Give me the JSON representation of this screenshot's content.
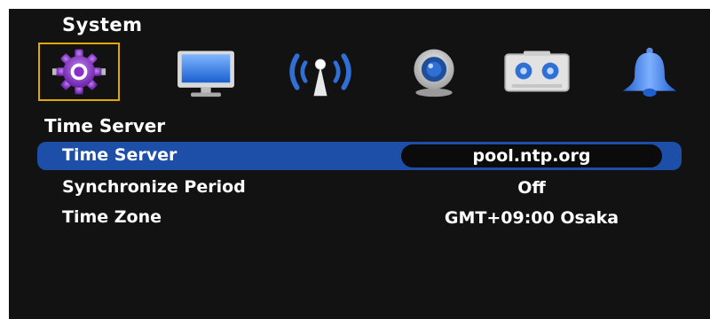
{
  "header": {
    "title": "System"
  },
  "menu_icons": [
    {
      "name": "gear-icon",
      "selected": true
    },
    {
      "name": "monitor-icon",
      "selected": false
    },
    {
      "name": "network-antenna-icon",
      "selected": false
    },
    {
      "name": "webcam-icon",
      "selected": false
    },
    {
      "name": "recorder-icon",
      "selected": false
    },
    {
      "name": "bell-icon",
      "selected": false
    }
  ],
  "section": {
    "title": "Time Server"
  },
  "settings": [
    {
      "label": "Time Server",
      "value": "pool.ntp.org",
      "selected": true
    },
    {
      "label": "Synchronize Period",
      "value": "Off",
      "selected": false
    },
    {
      "label": "Time Zone",
      "value": "GMT+09:00 Osaka",
      "selected": false
    }
  ],
  "colors": {
    "background": "#121212",
    "selection_bar": "#1d4ea8",
    "focus_border": "#e3a800",
    "gear_purple": "#8a2fc9",
    "icon_blue": "#2f6fd6"
  }
}
